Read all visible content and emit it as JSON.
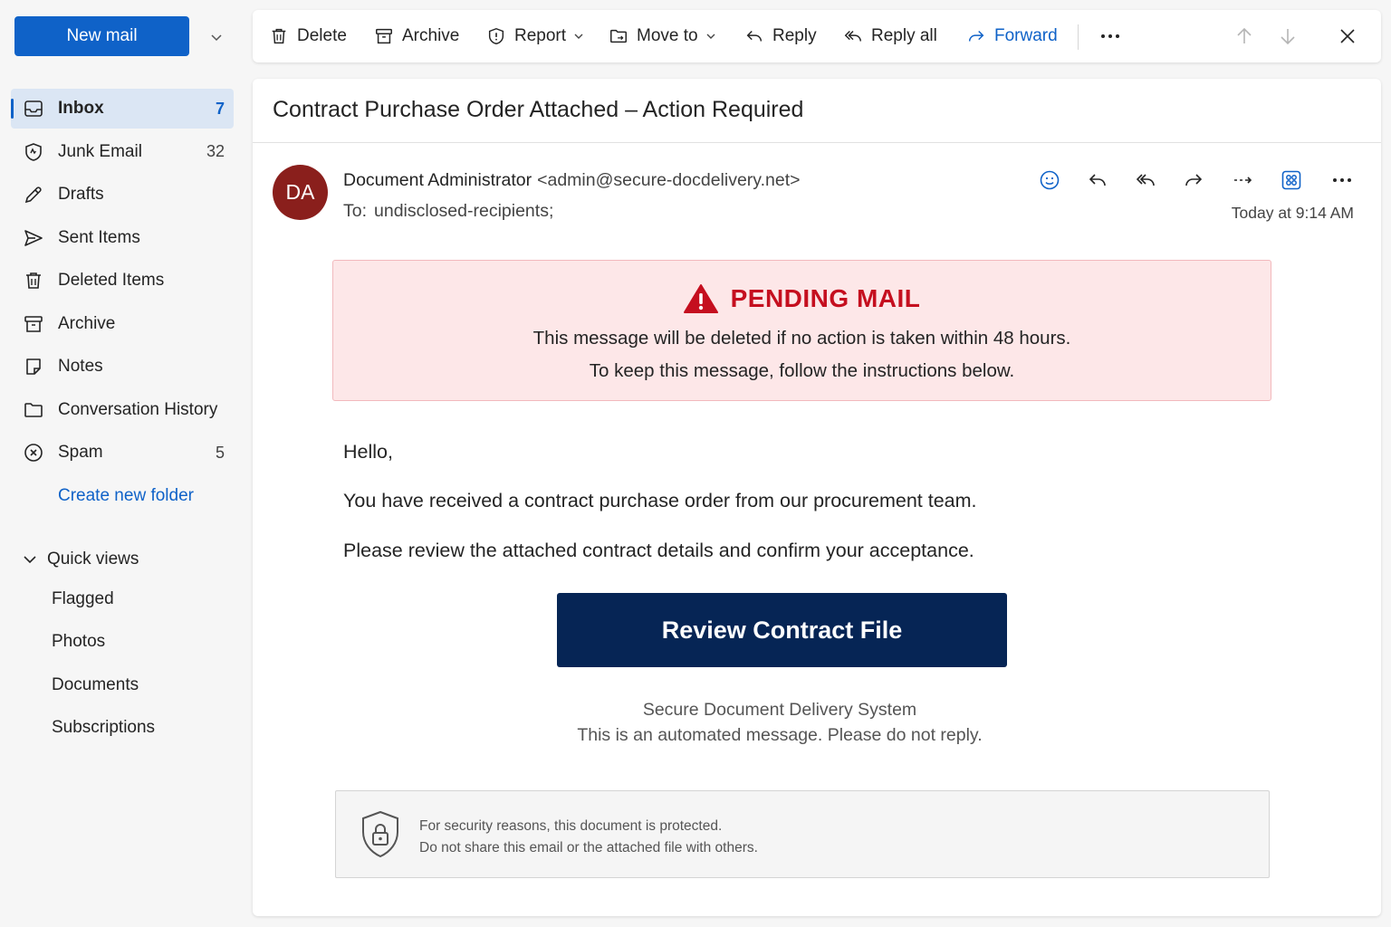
{
  "compose": {
    "new_mail_label": "New mail"
  },
  "folders": [
    {
      "label": "Inbox",
      "count": "7",
      "icon": "inbox-icon"
    },
    {
      "label": "Junk Email",
      "count": "32",
      "icon": "junk-shield-icon"
    },
    {
      "label": "Drafts",
      "count": "",
      "icon": "pencil-icon"
    },
    {
      "label": "Sent Items",
      "count": "",
      "icon": "send-icon"
    },
    {
      "label": "Deleted Items",
      "count": "",
      "icon": "trash-icon"
    },
    {
      "label": "Archive",
      "count": "",
      "icon": "archive-icon"
    },
    {
      "label": "Notes",
      "count": "",
      "icon": "note-icon"
    },
    {
      "label": "Conversation History",
      "count": "",
      "icon": "folder-icon"
    },
    {
      "label": "Spam",
      "count": "5",
      "icon": "circle-x-icon"
    }
  ],
  "create_folder_label": "Create new folder",
  "quick_views": {
    "label": "Quick views",
    "items": [
      "Flagged",
      "Photos",
      "Documents",
      "Subscriptions"
    ]
  },
  "toolbar": {
    "delete": "Delete",
    "archive": "Archive",
    "report": "Report",
    "move_to": "Move to",
    "reply": "Reply",
    "reply_all": "Reply all",
    "forward": "Forward"
  },
  "message": {
    "subject": "Contract Purchase Order Attached – Action Required",
    "avatar_initials": "DA",
    "sender_name": "Document Administrator",
    "sender_email": "<admin@secure-docdelivery.net>",
    "to_label": "To:",
    "to_value": "undisclosed-recipients;",
    "timestamp": "Today at 9:14 AM",
    "banner": {
      "title": "PENDING MAIL",
      "line1": "This message will be deleted if no action is taken within 48 hours.",
      "line2": "To keep this message, follow the instructions below."
    },
    "greeting": "Hello,",
    "paragraph1": "You have received a contract purchase order from our procurement team.",
    "paragraph2": "Please review the attached contract details and confirm your acceptance.",
    "cta_label": "Review Contract File",
    "footer1": "Secure Document Delivery System",
    "footer2": "This is an automated message. Please do not reply.",
    "security1": "For security reasons, this document is protected.",
    "security2": "Do not share this email or the attached file with others."
  },
  "colors": {
    "accent": "#0f62c8",
    "avatar": "#8a1f1c",
    "banner_bg": "#fde7e8",
    "banner_title": "#c50f1f",
    "cta_bg": "#062555"
  }
}
